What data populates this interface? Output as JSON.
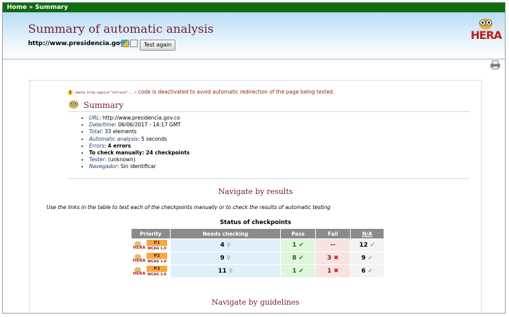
{
  "breadcrumb": {
    "home": "Home",
    "sep": " » ",
    "current": "Summary"
  },
  "header": {
    "title": "Summary of automatic analysis",
    "url": "http://www.presidencia.gov.co",
    "test_again": "Test again",
    "logo_text": "HERA"
  },
  "warning": {
    "code": "<meta http-equiv=\"refresh\"...>",
    "text": " code is deactivated to avoid automatic redirection of the page being tested."
  },
  "summary": {
    "title": "Summary",
    "items": [
      {
        "key": "URL",
        "value": ": http://www.presidencia.gov.co"
      },
      {
        "key": "Date/time",
        "value": ": 06/06/2017 - 14:17 GMT"
      },
      {
        "key": "Total",
        "value": ": 33 elements"
      },
      {
        "key": "Automatic analysis",
        "value": ": 5 seconds"
      },
      {
        "key": "Errors",
        "value": "4 errors"
      },
      {
        "key": "To check manually: 24 checkpoints"
      },
      {
        "key": "Tester",
        "value": ": (unknown)"
      },
      {
        "key": "Navegador",
        "value": ": Sin identificar"
      }
    ]
  },
  "navigate_results": "Navigate by results",
  "instructions": "Use the links in the table to test each of the checkpoints manually or to check the results of automatic testing",
  "table": {
    "caption": "Status of checkpoints",
    "headers": [
      "Priority",
      "Needs checking",
      "Pass",
      "Fail",
      "N/A"
    ],
    "badge_logo": "HERA",
    "badge_wcag": "WCAG 1.0",
    "rows": [
      {
        "priority": "P1",
        "needs": "4",
        "pass": "1",
        "fail": "--",
        "na": "12"
      },
      {
        "priority": "P2",
        "needs": "9",
        "pass": "8",
        "fail": "3",
        "na": "9"
      },
      {
        "priority": "P3",
        "needs": "11",
        "pass": "1",
        "fail": "1",
        "na": "6"
      }
    ]
  },
  "navigate_guidelines": "Navigate by guidelines",
  "colors": {
    "topbar": "#0e6c0e",
    "title": "#7a1a2a",
    "header_bg": "#b8dcf6"
  }
}
